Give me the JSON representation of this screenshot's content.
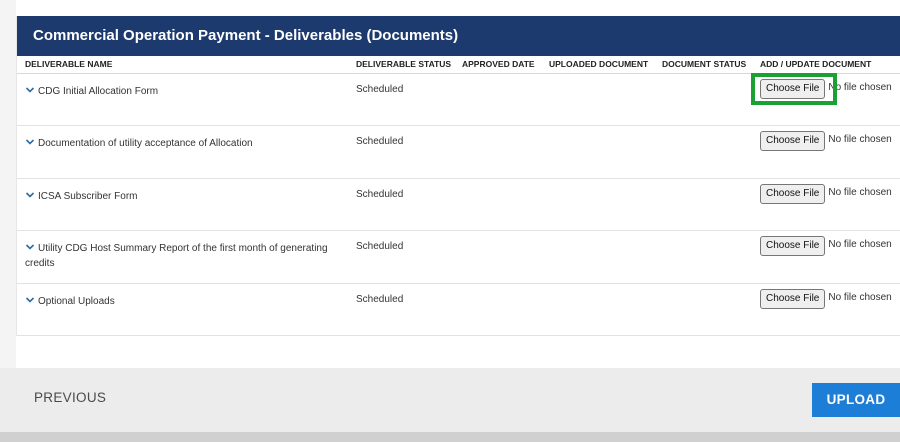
{
  "panel": {
    "title": "Commercial Operation Payment - Deliverables (Documents)"
  },
  "table": {
    "headers": [
      "DELIVERABLE NAME",
      "DELIVERABLE STATUS",
      "APPROVED DATE",
      "UPLOADED DOCUMENT",
      "DOCUMENT STATUS",
      "ADD / UPDATE DOCUMENT"
    ],
    "rows": [
      {
        "name": "CDG Initial Allocation Form",
        "status": "Scheduled",
        "approved_date": "",
        "uploaded_document": "",
        "document_status": "",
        "button": "Choose File",
        "file_state": "No file chosen"
      },
      {
        "name": "Documentation of utility acceptance of Allocation",
        "status": "Scheduled",
        "approved_date": "",
        "uploaded_document": "",
        "document_status": "",
        "button": "Choose File",
        "file_state": "No file chosen"
      },
      {
        "name": "ICSA Subscriber Form",
        "status": "Scheduled",
        "approved_date": "",
        "uploaded_document": "",
        "document_status": "",
        "button": "Choose File",
        "file_state": "No file chosen"
      },
      {
        "name": "Utility CDG Host Summary Report of the first month of generating credits",
        "status": "Scheduled",
        "approved_date": "",
        "uploaded_document": "",
        "document_status": "",
        "button": "Choose File",
        "file_state": "No file chosen"
      },
      {
        "name": "Optional Uploads",
        "status": "Scheduled",
        "approved_date": "",
        "uploaded_document": "",
        "document_status": "",
        "button": "Choose File",
        "file_state": "No file chosen"
      }
    ]
  },
  "footer": {
    "previous_label": "PREVIOUS",
    "upload_label": "UPLOAD"
  },
  "icons": {
    "row_toggle": "chevron-down-icon"
  },
  "colors": {
    "header_bg": "#1d3a6e",
    "link": "#2b6ca3",
    "primary_button": "#1c7ed6",
    "highlight": "#1aa033"
  }
}
